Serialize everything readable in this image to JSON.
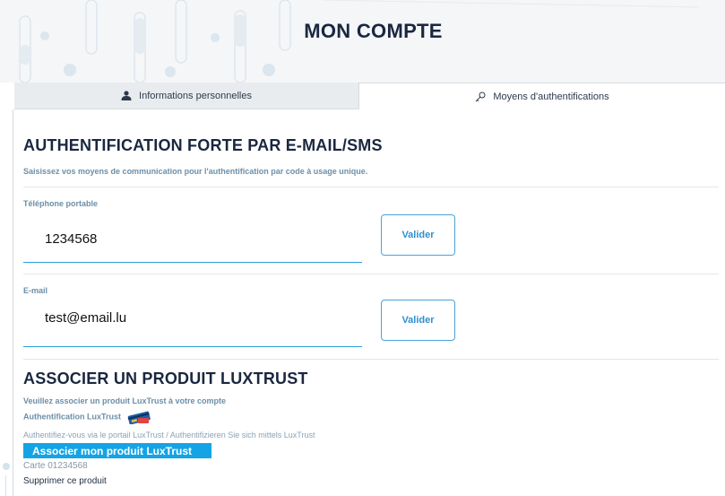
{
  "header": {
    "title": "MON COMPTE"
  },
  "tabs": [
    {
      "label": "Informations personnelles",
      "icon": "user-icon",
      "active": false
    },
    {
      "label": "Moyens d'authentifications",
      "icon": "key-icon",
      "active": true
    }
  ],
  "sms_section": {
    "title": "AUTHENTIFICATION FORTE PAR E-MAIL/SMS",
    "subtitle": "Saisissez vos moyens de communication pour l'authentification par code à usage unique.",
    "phone": {
      "label": "Téléphone portable",
      "value": "1234568",
      "button": "Valider"
    },
    "email": {
      "label": "E-mail",
      "value": "test@email.lu",
      "button": "Valider"
    }
  },
  "luxtrust_section": {
    "title": "ASSOCIER UN PRODUIT LUXTRUST",
    "intro": "Veuillez associer un produit LuxTrust à votre compte",
    "auth_label": "Authentification LuxTrust",
    "portal_text": "Authentifiez-vous via le portail LuxTrust / Authentifizieren Sie sich mittels LuxTrust",
    "associate_button": "Associer mon produit LuxTrust",
    "card_text": "Carte 01234568",
    "delete_text": "Supprimer ce produit"
  },
  "colors": {
    "accent": "#14a4e6",
    "button_border": "#4aa3d9",
    "label": "#6b8fa8",
    "title": "#1a2740"
  }
}
